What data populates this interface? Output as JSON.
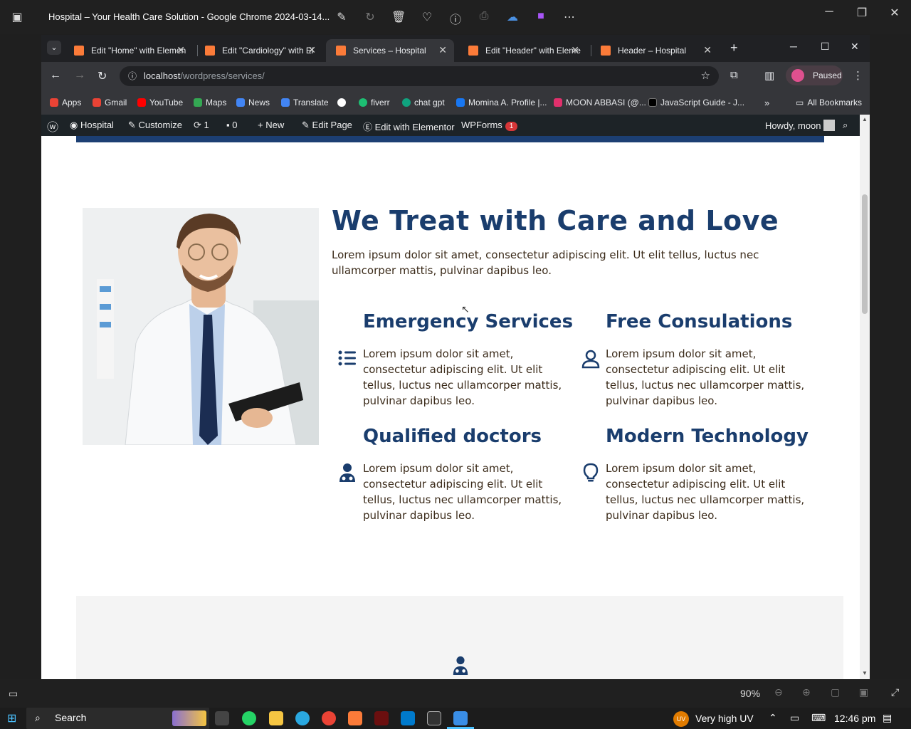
{
  "photos_app": {
    "title": "Hospital – Your Health Care Solution - Google Chrome 2024-03-14...",
    "toolbar_icons": [
      "edit-icon",
      "rotate-icon",
      "delete-icon",
      "favorite-icon",
      "info-icon",
      "print-icon",
      "onedrive-icon",
      "clipchamp-icon",
      "more-icon"
    ]
  },
  "browser": {
    "tabs": [
      {
        "label": "Edit \"Home\" with Elemen"
      },
      {
        "label": "Edit \"Cardiology\" with El"
      },
      {
        "label": "Services – Hospital",
        "active": true
      },
      {
        "label": "Edit \"Header\" with Eleme"
      },
      {
        "label": "Header – Hospital"
      }
    ],
    "url_host": "localhost",
    "url_path": "/wordpress/services/",
    "profile_label": "Paused",
    "bookmarks": [
      {
        "label": "Apps",
        "color": "#ea4335"
      },
      {
        "label": "Gmail",
        "color": "#ea4335"
      },
      {
        "label": "YouTube",
        "color": "#ff0000"
      },
      {
        "label": "Maps",
        "color": "#34a853"
      },
      {
        "label": "News",
        "color": "#4285f4"
      },
      {
        "label": "Translate",
        "color": "#4285f4"
      },
      {
        "label": "",
        "color": "#ffffff"
      },
      {
        "label": "fiverr",
        "color": "#1dbf73"
      },
      {
        "label": "chat gpt",
        "color": "#10a37f"
      },
      {
        "label": "Momina A. Profile |...",
        "color": "#1877f2"
      },
      {
        "label": "MOON ABBASI (@...",
        "color": "#e1306c"
      },
      {
        "label": "JavaScript Guide - J...",
        "color": "#000000"
      }
    ],
    "all_bookmarks": "All Bookmarks"
  },
  "wp_admin_bar": {
    "site": "Hospital",
    "customize": "Customize",
    "updates": "1",
    "comments": "0",
    "new": "New",
    "edit_page": "Edit Page",
    "elementor": "Edit with Elementor",
    "wpforms": "WPForms",
    "wpforms_count": "1",
    "howdy": "Howdy, moon"
  },
  "content": {
    "heading": "We Treat with Care and Love",
    "intro": "Lorem ipsum dolor sit amet, consectetur adipiscing elit. Ut elit tellus, luctus nec ullamcorper mattis, pulvinar dapibus leo.",
    "services": [
      {
        "title": "Emergency Services",
        "icon": "list-icon",
        "text": "Lorem ipsum dolor sit amet, consectetur adipiscing elit. Ut elit tellus, luctus nec ullamcorper mattis, pulvinar dapibus leo."
      },
      {
        "title": "Free Consulations",
        "icon": "user-icon",
        "text": "Lorem ipsum dolor sit amet, consectetur adipiscing elit. Ut elit tellus, luctus nec ullamcorper mattis, pulvinar dapibus leo."
      },
      {
        "title": "Qualified doctors",
        "icon": "doctor-icon",
        "text": "Lorem ipsum dolor sit amet, consectetur adipiscing elit. Ut elit tellus, luctus nec ullamcorper mattis, pulvinar dapibus leo."
      },
      {
        "title": "Modern Technology",
        "icon": "lightbulb-icon",
        "text": "Lorem ipsum dolor sit amet, consectetur adipiscing elit. Ut elit tellus, luctus nec ullamcorper mattis, pulvinar dapibus leo."
      }
    ],
    "brand_color": "#1a3d6d"
  },
  "photos_status": {
    "zoom": "90%"
  },
  "taskbar": {
    "search": "Search",
    "weather": "Very high UV",
    "weather_badge": "UV",
    "time": "12:46 pm"
  }
}
